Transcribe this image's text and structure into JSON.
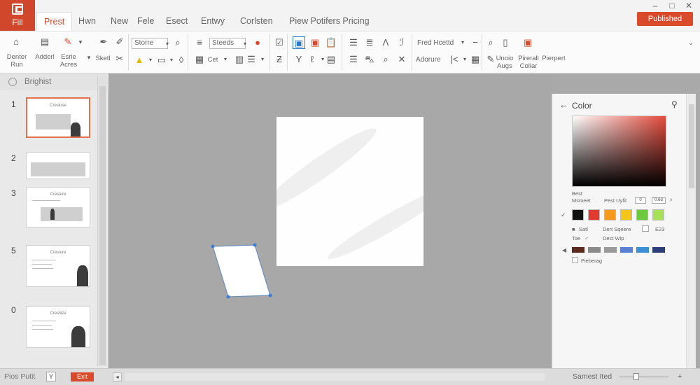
{
  "title_bar": {
    "file_label": "Fill",
    "tabs": [
      "Prest",
      "Hwn",
      "New",
      "Fele",
      "Esect",
      "Entwy",
      "Corlsten",
      "Piew Potifers Pricing"
    ],
    "active_tab": "Prest",
    "published_button": "Published",
    "window_controls": [
      "–",
      "□",
      "✕"
    ]
  },
  "ribbon": {
    "labels": {
      "denter_run": "Denter\nRun",
      "adderl": "Adderl",
      "esrie_acres": "Esrie\nAcres",
      "sketl": "Sketl",
      "cet": "Cet",
      "adorure": "Adorure",
      "undio_augs": "Unoio\nAugs",
      "pirerall_collar": "Pirerall\nCollar",
      "pierpert": "Pierpert"
    },
    "fields": {
      "font_style": "Storre",
      "font_size": "Steeds",
      "heading": "Fred Hcettd"
    }
  },
  "left_panel": {
    "title": "Brighist",
    "slides": [
      {
        "number": "1",
        "title": "Cresiuse"
      },
      {
        "number": "2",
        "title": ""
      },
      {
        "number": "3",
        "title": "Cresiure"
      },
      {
        "number": "5",
        "title": "Cresiure"
      },
      {
        "number": "0",
        "title": "Cresilize"
      }
    ]
  },
  "status_bar": {
    "left_text": "Pios Putit",
    "y_box": "Y",
    "exit_button": "Exit",
    "right_text": "Samest Ited",
    "zoom_plus": "+"
  },
  "color_panel": {
    "title": "Color",
    "best_label": "Best",
    "msmeet_label": "Msmeet",
    "pest_uyfit": "Pest Uyfit",
    "box_a": "0",
    "box_b": "0.6d",
    "satl": "Satl",
    "dert_sqeere": "Dert Sqeere",
    "num_value": "E23",
    "toe": "Toe",
    "dect_wip": "Dect Wip",
    "pieberag": "Pieberag",
    "swatches_row1": [
      "#111111",
      "#e03b31",
      "#f39a1f",
      "#f5c61a",
      "#6cc93b",
      "#a8e05a"
    ],
    "swatches_row2": [
      "#5a2a1f",
      "#8a8a8a",
      "#9a9a9a",
      "#5b7fd1",
      "#3b8fd5",
      "#2b3e78"
    ]
  },
  "colors": {
    "accent": "#d94a2b",
    "ribbon_bg": "#fbfbfb",
    "canvas_bg": "#a8a8a8"
  }
}
